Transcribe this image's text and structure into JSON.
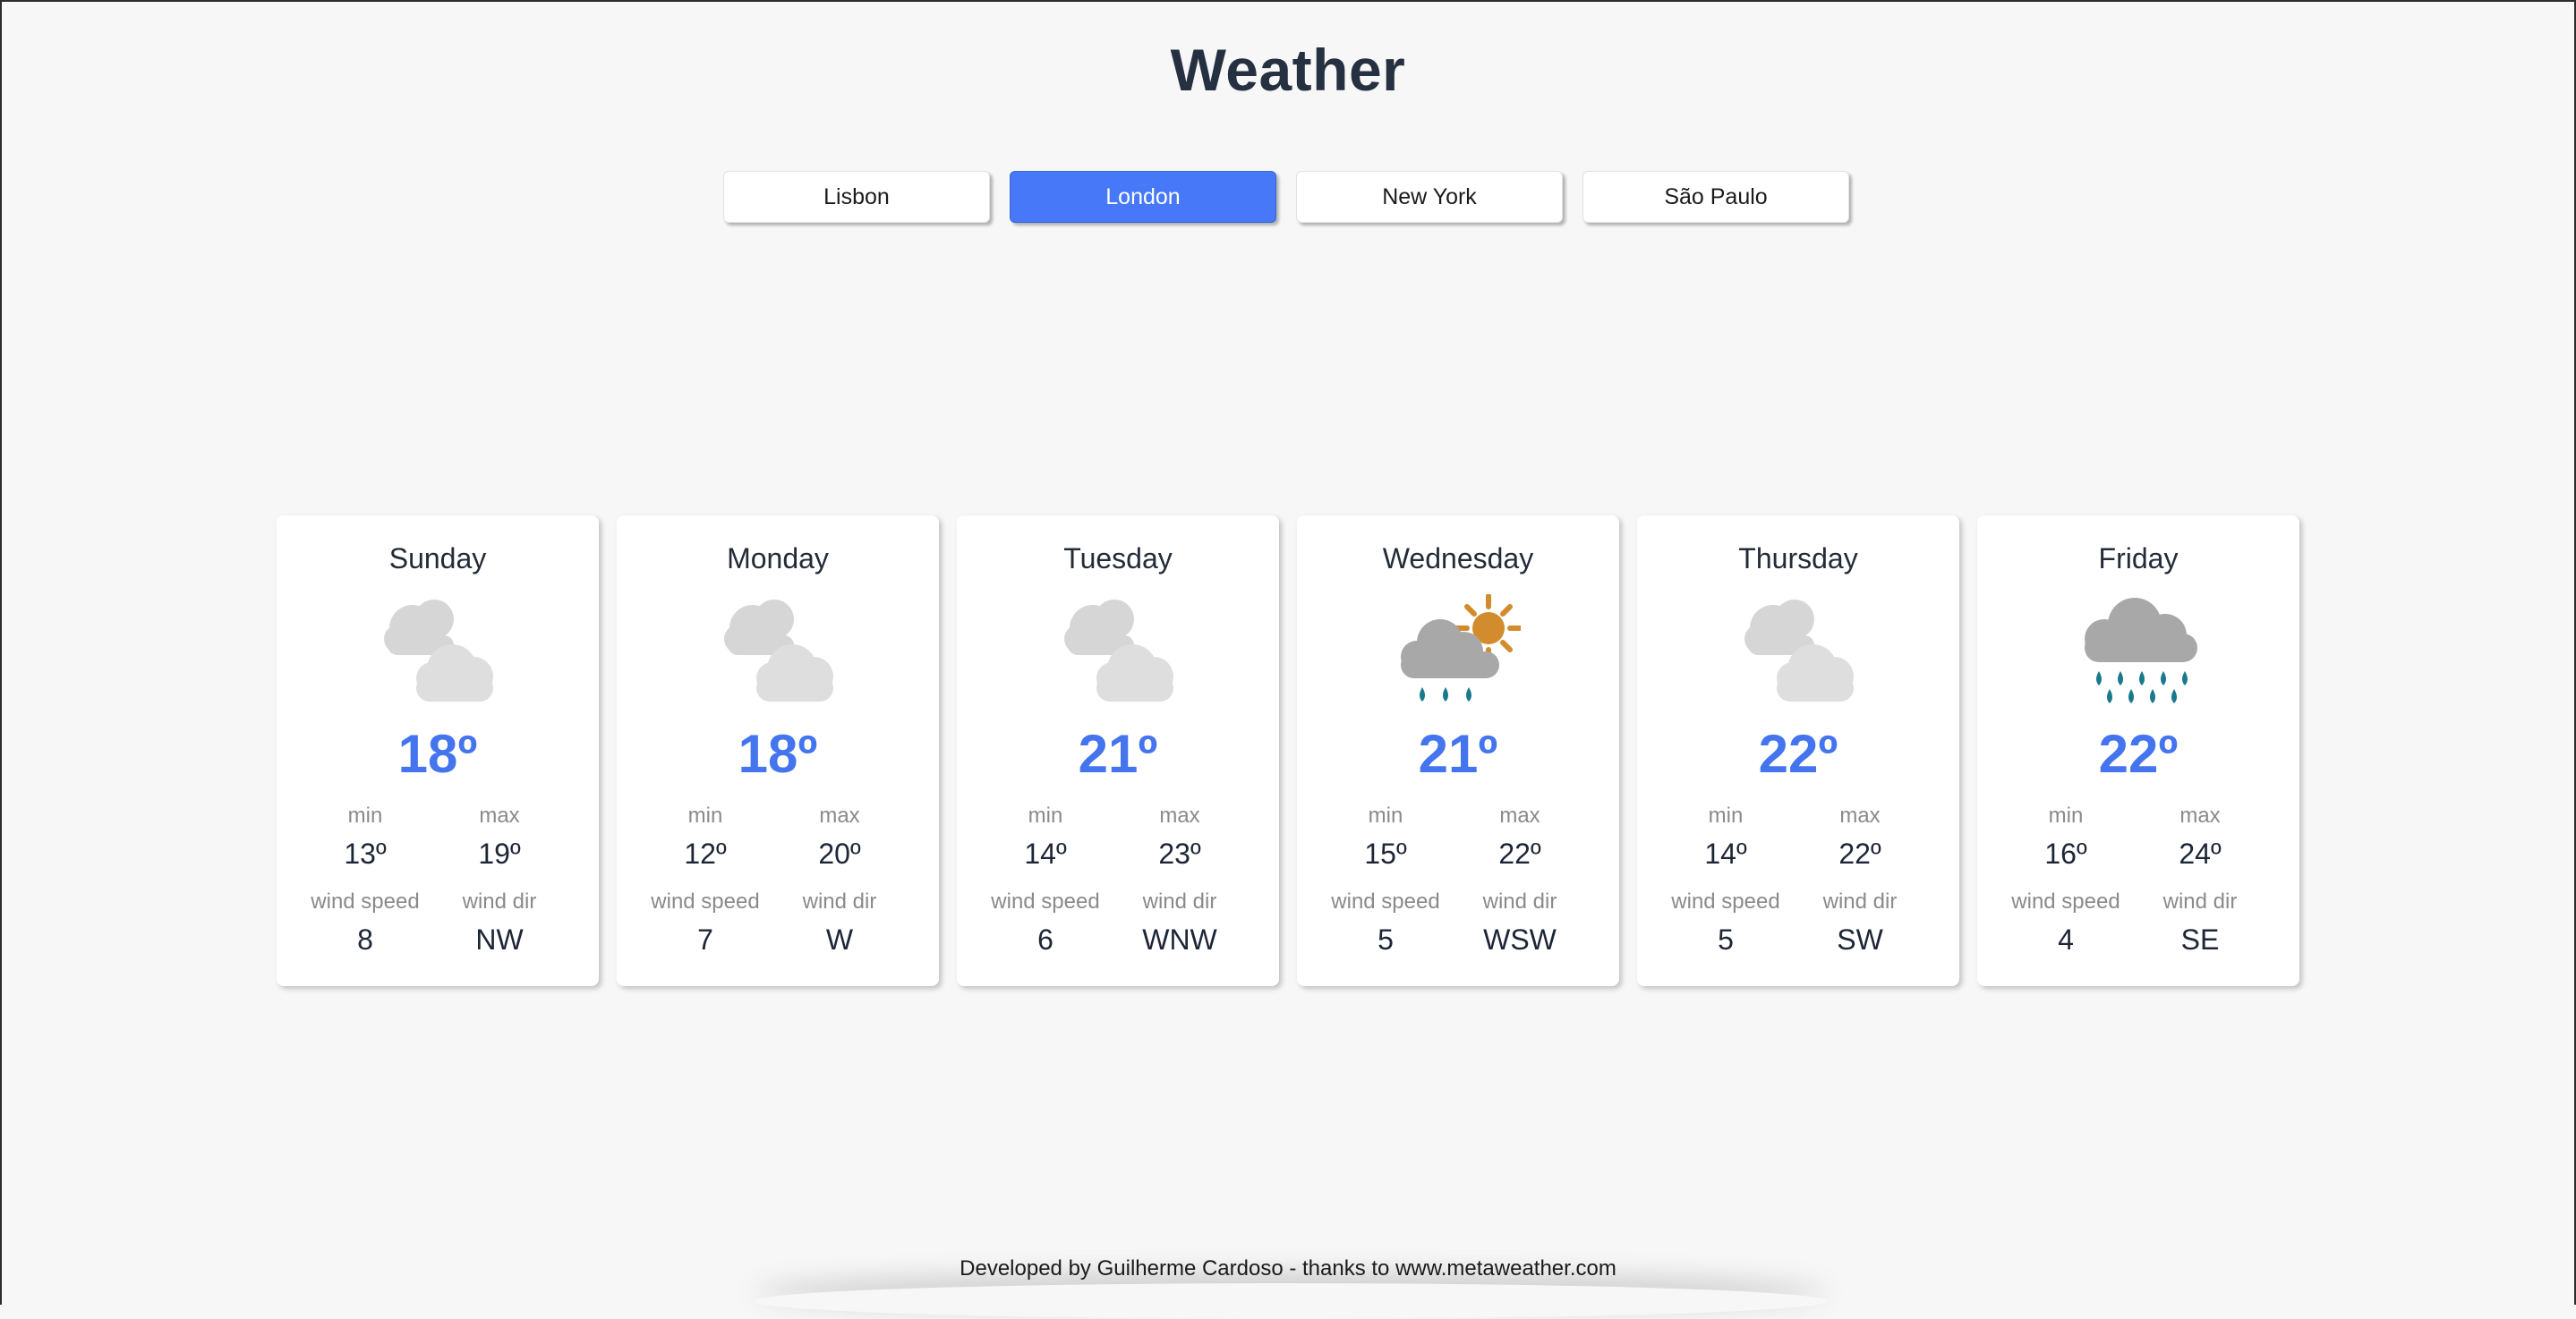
{
  "header": {
    "title": "Weather"
  },
  "cities": [
    {
      "label": "Lisbon",
      "active": false
    },
    {
      "label": "London",
      "active": true
    },
    {
      "label": "New York",
      "active": false
    },
    {
      "label": "São Paulo",
      "active": false
    }
  ],
  "labels": {
    "min": "min",
    "max": "max",
    "wind_speed": "wind speed",
    "wind_dir": "wind dir"
  },
  "forecast": [
    {
      "day": "Sunday",
      "icon": "cloudy-icon",
      "temp": "18º",
      "min": "13º",
      "max": "19º",
      "wind_speed": "8",
      "wind_dir": "NW"
    },
    {
      "day": "Monday",
      "icon": "cloudy-icon",
      "temp": "18º",
      "min": "12º",
      "max": "20º",
      "wind_speed": "7",
      "wind_dir": "W"
    },
    {
      "day": "Tuesday",
      "icon": "cloudy-icon",
      "temp": "21º",
      "min": "14º",
      "max": "23º",
      "wind_speed": "6",
      "wind_dir": "WNW"
    },
    {
      "day": "Wednesday",
      "icon": "sun-shower-icon",
      "temp": "21º",
      "min": "15º",
      "max": "22º",
      "wind_speed": "5",
      "wind_dir": "WSW"
    },
    {
      "day": "Thursday",
      "icon": "cloudy-icon",
      "temp": "22º",
      "min": "14º",
      "max": "22º",
      "wind_speed": "5",
      "wind_dir": "SW"
    },
    {
      "day": "Friday",
      "icon": "rain-icon",
      "temp": "22º",
      "min": "16º",
      "max": "24º",
      "wind_speed": "4",
      "wind_dir": "SE"
    }
  ],
  "footer": {
    "text": "Developed by Guilherme Cardoso - thanks to www.metaweather.com"
  },
  "colors": {
    "accent": "#4778f7",
    "temp": "#4474ee",
    "background": "#f7f7f7"
  }
}
